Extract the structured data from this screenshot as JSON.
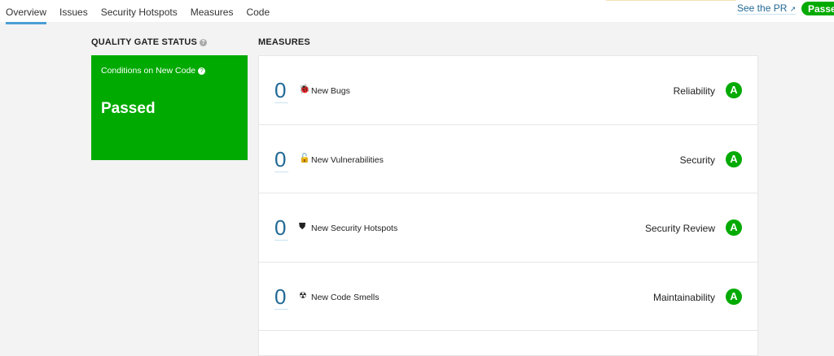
{
  "nav": {
    "tabs": [
      "Overview",
      "Issues",
      "Security Hotspots",
      "Measures",
      "Code"
    ],
    "active": 0,
    "see_pr": "See the PR",
    "status_badge": "Passed"
  },
  "quality_gate": {
    "heading": "QUALITY GATE STATUS",
    "conditions": "Conditions on New Code",
    "status": "Passed",
    "color": "#00aa00"
  },
  "measures": {
    "heading": "MEASURES",
    "rows": [
      {
        "value": "0",
        "label": "New Bugs",
        "icon": "bug-icon",
        "category": "Reliability",
        "grade": "A"
      },
      {
        "value": "0",
        "label": "New Vulnerabilities",
        "icon": "unlock-icon",
        "category": "Security",
        "grade": "A"
      },
      {
        "value": "0",
        "label": "New Security Hotspots",
        "icon": "shield-icon",
        "category": "Security Review",
        "grade": "A"
      },
      {
        "value": "0",
        "label": "New Code Smells",
        "icon": "code-smell-icon",
        "category": "Maintainability",
        "grade": "A"
      }
    ]
  }
}
